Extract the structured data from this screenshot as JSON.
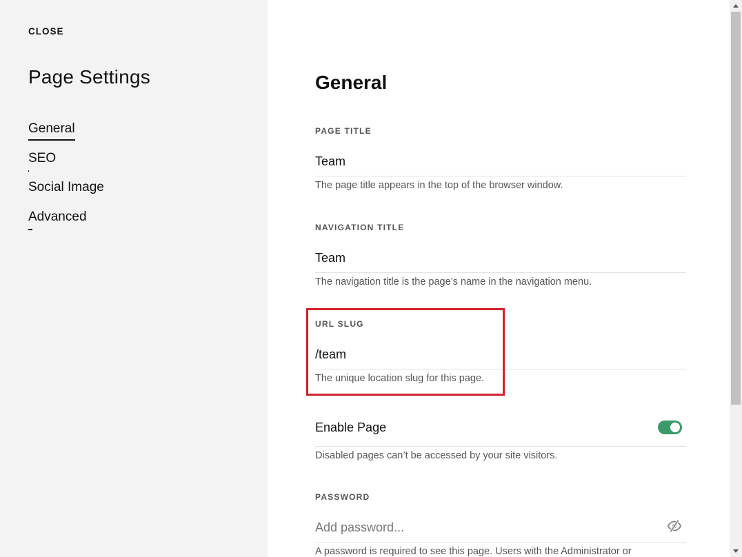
{
  "sidebar": {
    "close_label": "CLOSE",
    "title": "Page Settings",
    "items": [
      {
        "label": "General",
        "active": true
      },
      {
        "label": "SEO"
      },
      {
        "label": "Social Image"
      },
      {
        "label": "Advanced"
      }
    ]
  },
  "main": {
    "title": "General",
    "page_title": {
      "label": "PAGE TITLE",
      "value": "Team",
      "help": "The page title appears in the top of the browser window."
    },
    "navigation_title": {
      "label": "NAVIGATION TITLE",
      "value": "Team",
      "help": "The navigation title is the page’s name in the navigation menu."
    },
    "url_slug": {
      "label": "URL SLUG",
      "value": "/team",
      "help": "The unique location slug for this page."
    },
    "enable_page": {
      "label": "Enable Page",
      "enabled": true,
      "help": "Disabled pages can’t be accessed by your site visitors."
    },
    "password": {
      "label": "PASSWORD",
      "placeholder": "Add password...",
      "help": "A password is required to see this page. Users with the Administrator or"
    }
  },
  "colors": {
    "sidebar_bg": "#f3f3f3",
    "toggle_on": "#3c9a6a",
    "highlight": "#d3202b"
  },
  "icons": {
    "password_visibility": "eye-off-icon"
  }
}
